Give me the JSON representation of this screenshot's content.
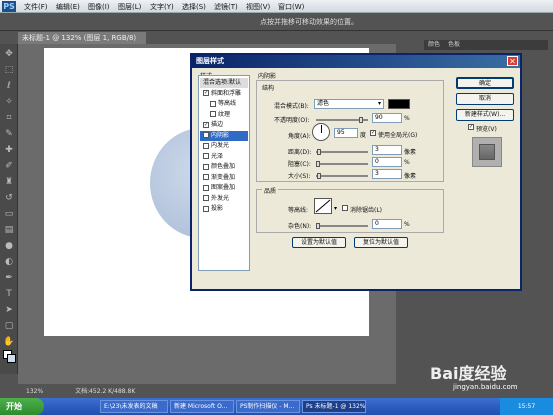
{
  "app": {
    "logo": "PS"
  },
  "menu": [
    "文件(F)",
    "编辑(E)",
    "图像(I)",
    "图层(L)",
    "文字(Y)",
    "选择(S)",
    "滤镜(T)",
    "视图(V)",
    "窗口(W)"
  ],
  "optbar": {
    "hint": "点按并拖移可移动效果的位置。"
  },
  "doc_tab": {
    "title": "未标题-1 @ 132% (图层 1, RGB/8) *",
    "close": "×"
  },
  "status": {
    "zoom": "132%",
    "doc": "文档:452.2 K/488.8K"
  },
  "right_panel": {
    "tabs": [
      "颜色",
      "色板"
    ]
  },
  "dialog": {
    "title": "图层样式",
    "close": "✕",
    "styles_header": "样式",
    "styles": [
      {
        "label": "混合选项:默认",
        "checkbox": false,
        "checked": false,
        "selected": false,
        "head": true
      },
      {
        "label": "斜面和浮雕",
        "checkbox": true,
        "checked": true,
        "selected": false
      },
      {
        "label": "等高线",
        "checkbox": true,
        "checked": false,
        "selected": false,
        "indent": true
      },
      {
        "label": "纹理",
        "checkbox": true,
        "checked": false,
        "selected": false,
        "indent": true
      },
      {
        "label": "描边",
        "checkbox": true,
        "checked": true,
        "selected": false
      },
      {
        "label": "内阴影",
        "checkbox": true,
        "checked": true,
        "selected": true
      },
      {
        "label": "内发光",
        "checkbox": true,
        "checked": false,
        "selected": false
      },
      {
        "label": "光泽",
        "checkbox": true,
        "checked": false,
        "selected": false
      },
      {
        "label": "颜色叠加",
        "checkbox": true,
        "checked": false,
        "selected": false
      },
      {
        "label": "渐变叠加",
        "checkbox": true,
        "checked": false,
        "selected": false
      },
      {
        "label": "图案叠加",
        "checkbox": true,
        "checked": false,
        "selected": false
      },
      {
        "label": "外发光",
        "checkbox": true,
        "checked": false,
        "selected": false
      },
      {
        "label": "投影",
        "checkbox": true,
        "checked": false,
        "selected": false
      }
    ],
    "section_title": "内阴影",
    "structure": {
      "title": "结构",
      "blend_mode_label": "混合模式(B):",
      "blend_mode_value": "滤色",
      "blend_color": "#000000",
      "opacity_label": "不透明度(O):",
      "opacity_value": "90",
      "opacity_unit": "%",
      "angle_label": "角度(A):",
      "angle_value": "95",
      "angle_unit": "度",
      "global_light_label": "使用全局光(G)",
      "global_light_checked": true,
      "distance_label": "距离(D):",
      "distance_value": "3",
      "distance_unit": "像素",
      "choke_label": "阻塞(C):",
      "choke_value": "0",
      "choke_unit": "%",
      "size_label": "大小(S):",
      "size_value": "3",
      "size_unit": "像素"
    },
    "quality": {
      "title": "品质",
      "contour_label": "等高线:",
      "antialias_label": "消除锯齿(L)",
      "noise_label": "杂色(N):",
      "noise_value": "0",
      "noise_unit": "%"
    },
    "make_default": "设置为默认值",
    "reset_default": "复位为默认值",
    "buttons": {
      "ok": "确定",
      "cancel": "取消",
      "new_style": "新建样式(W)...",
      "preview_label": "预览(V)"
    }
  },
  "taskbar": {
    "start": "开始",
    "tasks": [
      {
        "label": "E:\\23\\未发表的文稿"
      },
      {
        "label": "新建 Microsoft O..."
      },
      {
        "label": "PS制作扫描仪 - M..."
      },
      {
        "label": "Ps 未标题-1 @ 132%"
      }
    ],
    "clock": "15:57"
  },
  "watermark": {
    "brand": "Bai度经验",
    "url": "jingyan.baidu.com"
  }
}
